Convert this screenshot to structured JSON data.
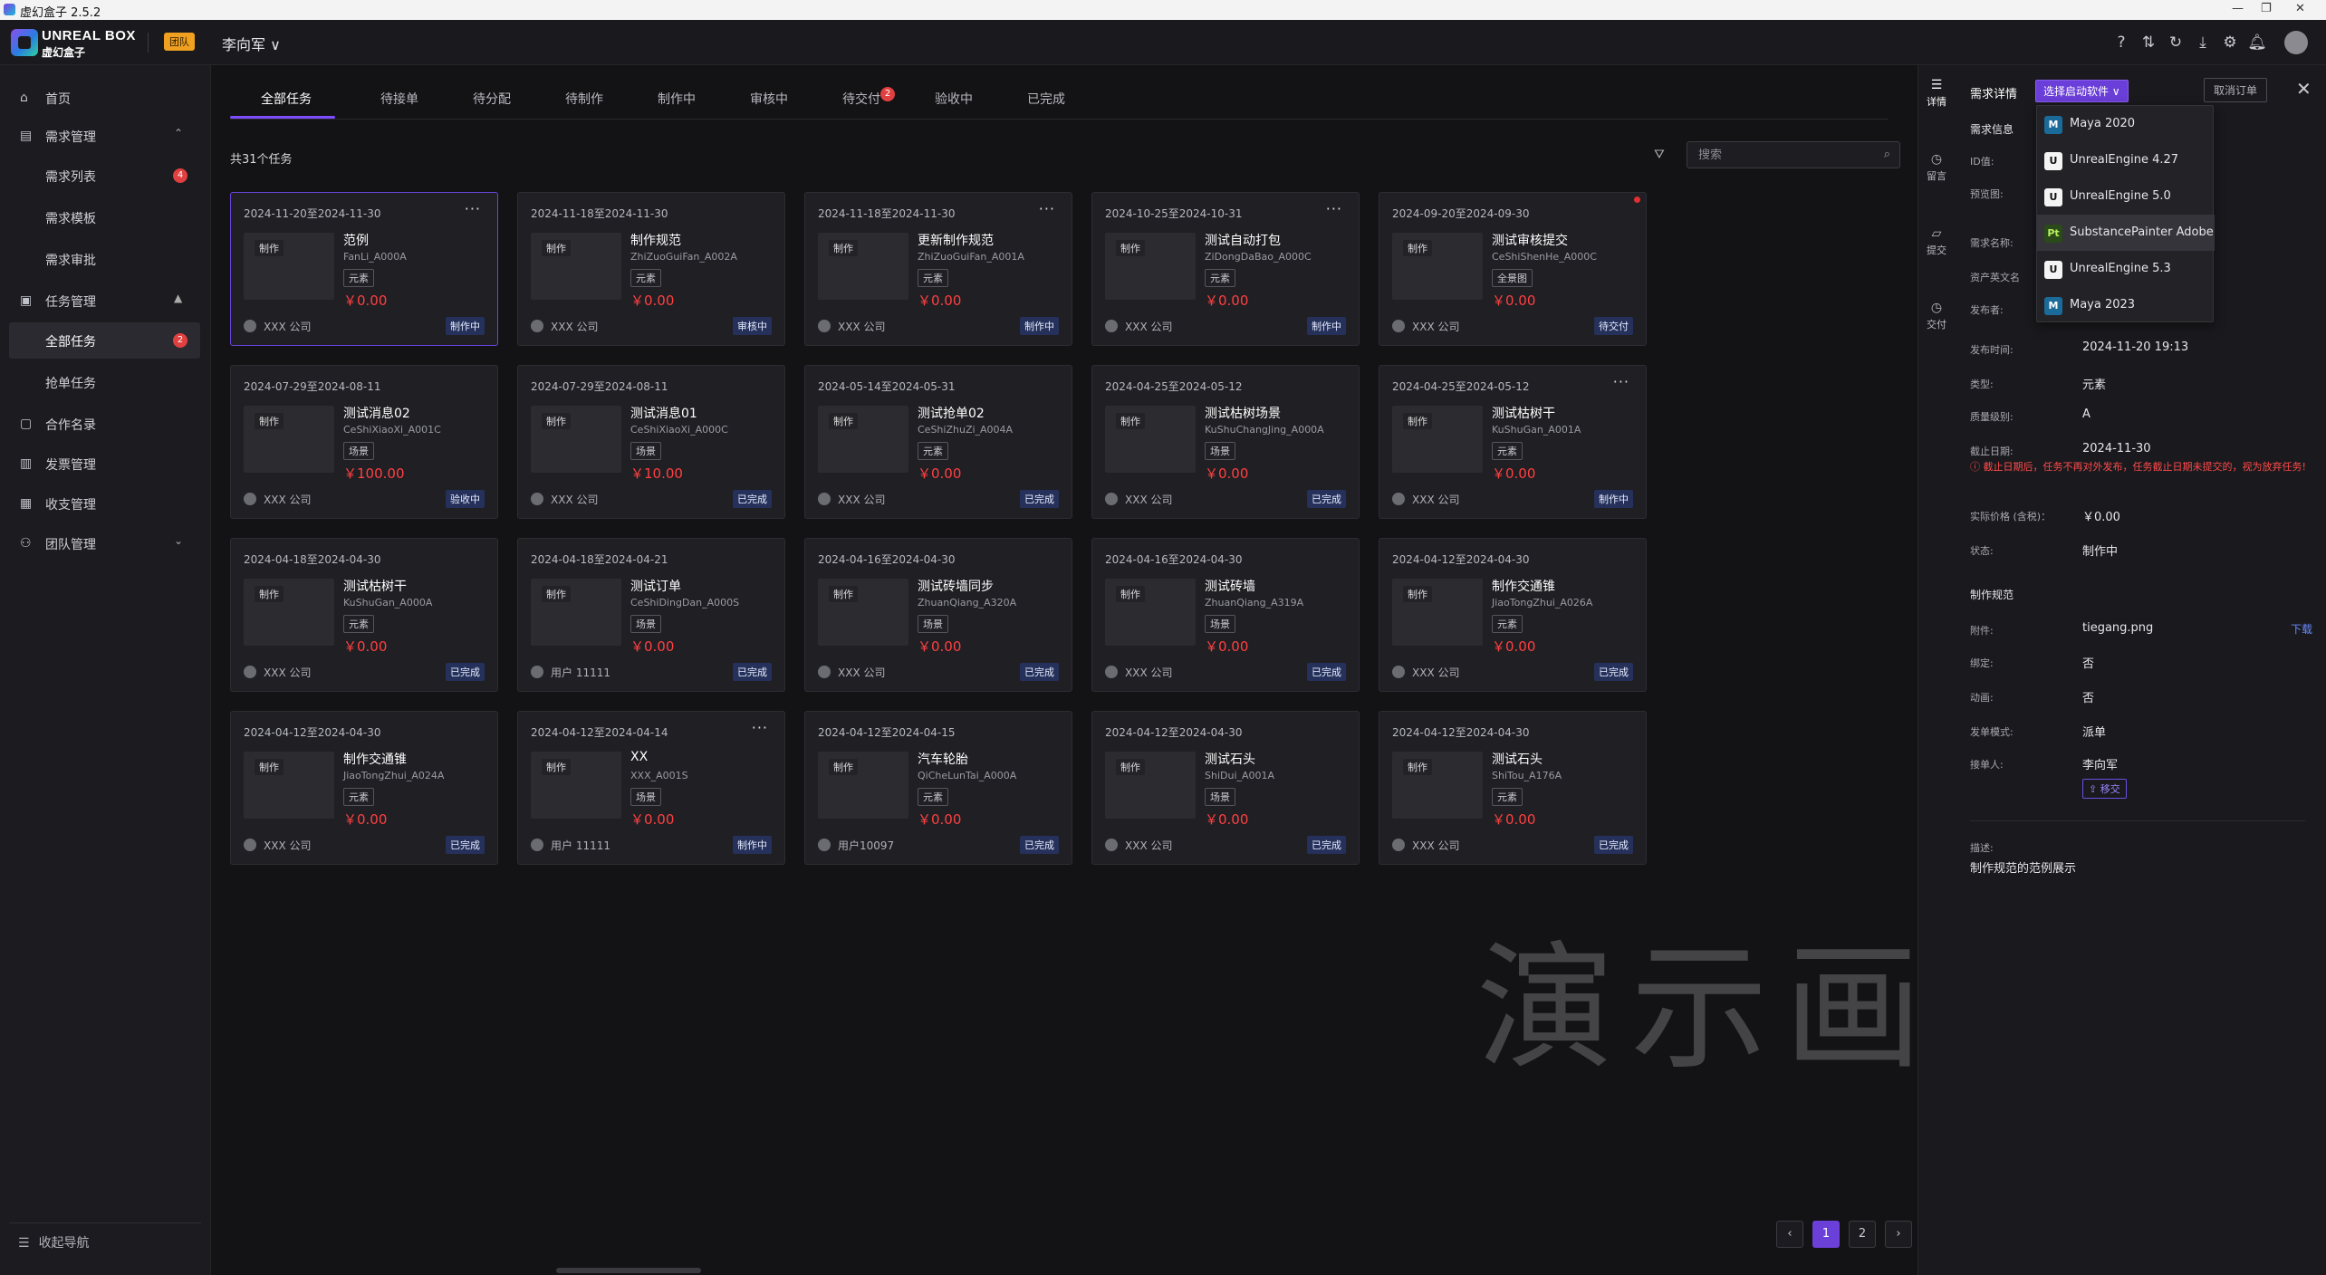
{
  "window": {
    "title": "虚幻盒子 2.5.2"
  },
  "header": {
    "logo_en": "UNREAL BOX",
    "logo_zh": "虚幻盒子",
    "team_badge": "团队",
    "user": "李向军",
    "icons": [
      "help-icon",
      "sort-icon",
      "refresh-icon",
      "download-icon",
      "settings-icon",
      "bell-icon"
    ]
  },
  "sidebar": {
    "items": [
      {
        "label": "首页",
        "icon": "home-icon"
      },
      {
        "label": "需求管理",
        "icon": "document-icon"
      },
      {
        "label": "需求列表",
        "badge": "4"
      },
      {
        "label": "需求模板"
      },
      {
        "label": "需求审批"
      },
      {
        "label": "任务管理",
        "icon": "task-icon"
      },
      {
        "label": "全部任务",
        "badge": "2"
      },
      {
        "label": "抢单任务"
      },
      {
        "label": "合作名录",
        "icon": "book-icon"
      },
      {
        "label": "发票管理",
        "icon": "invoice-icon"
      },
      {
        "label": "收支管理",
        "icon": "wallet-icon"
      },
      {
        "label": "团队管理",
        "icon": "team-icon"
      }
    ],
    "collapse": "收起导航"
  },
  "tabs": [
    {
      "label": "全部任务"
    },
    {
      "label": "待接单"
    },
    {
      "label": "待分配"
    },
    {
      "label": "待制作"
    },
    {
      "label": "制作中"
    },
    {
      "label": "审核中"
    },
    {
      "label": "待交付",
      "badge": "2"
    },
    {
      "label": "验收中"
    },
    {
      "label": "已完成"
    }
  ],
  "list": {
    "total": "共31个任务",
    "search_placeholder": "搜索"
  },
  "cards": [
    {
      "date": "2024-11-20至2024-11-30",
      "tag": "制作",
      "name": "范例",
      "code": "FanLi_A000A",
      "cat": "元素",
      "price": "￥0.00",
      "owner": "XXX 公司",
      "status": "制作中",
      "thumb": "pot",
      "more": true
    },
    {
      "date": "2024-11-18至2024-11-30",
      "tag": "制作",
      "name": "制作规范",
      "code": "ZhiZuoGuiFan_A002A",
      "cat": "元素",
      "price": "￥0.00",
      "owner": "XXX 公司",
      "status": "审核中",
      "thumb": "pot2"
    },
    {
      "date": "2024-11-18至2024-11-30",
      "tag": "制作",
      "name": "更新制作规范",
      "code": "ZhiZuoGuiFan_A001A",
      "cat": "元素",
      "price": "￥0.00",
      "owner": "XXX 公司",
      "status": "制作中",
      "thumb": "color",
      "more": true
    },
    {
      "date": "2024-10-25至2024-10-31",
      "tag": "制作",
      "name": "测试自动打包",
      "code": "ZiDongDaBao_A000C",
      "cat": "元素",
      "price": "￥0.00",
      "owner": "XXX 公司",
      "status": "制作中",
      "thumb": "root",
      "more": true
    },
    {
      "date": "2024-09-20至2024-09-30",
      "tag": "制作",
      "name": "测试审核提交",
      "code": "CeShiShenHe_A000C",
      "cat": "全景图",
      "price": "￥0.00",
      "owner": "XXX 公司",
      "status": "待交付",
      "thumb": "ui",
      "dot": true
    },
    {
      "date": "2024-07-29至2024-08-11",
      "tag": "制作",
      "name": "测试消息02",
      "code": "CeShiXiaoXi_A001C",
      "cat": "场景",
      "price": "￥100.00",
      "owner": "XXX 公司",
      "status": "验收中",
      "thumb": "house"
    },
    {
      "date": "2024-07-29至2024-08-11",
      "tag": "制作",
      "name": "测试消息01",
      "code": "CeShiXiaoXi_A000C",
      "cat": "场景",
      "price": "￥10.00",
      "owner": "XXX 公司",
      "status": "已完成",
      "thumb": "logo"
    },
    {
      "date": "2024-05-14至2024-05-31",
      "tag": "制作",
      "name": "测试抢单02",
      "code": "CeShiZhuZi_A004A",
      "cat": "元素",
      "price": "￥0.00",
      "owner": "XXX 公司",
      "status": "已完成",
      "thumb": "root"
    },
    {
      "date": "2024-04-25至2024-05-12",
      "tag": "制作",
      "name": "测试枯树场景",
      "code": "KuShuChangJing_A000A",
      "cat": "场景",
      "price": "￥0.00",
      "owner": "XXX 公司",
      "status": "已完成",
      "thumb": "root"
    },
    {
      "date": "2024-04-25至2024-05-12",
      "tag": "制作",
      "name": "测试枯树干",
      "code": "KuShuGan_A001A",
      "cat": "元素",
      "price": "￥0.00",
      "owner": "XXX 公司",
      "status": "制作中",
      "thumb": "root",
      "more": true
    },
    {
      "date": "2024-04-18至2024-04-30",
      "tag": "制作",
      "name": "测试枯树干",
      "code": "KuShuGan_A000A",
      "cat": "元素",
      "price": "￥0.00",
      "owner": "XXX 公司",
      "status": "已完成",
      "thumb": "logo"
    },
    {
      "date": "2024-04-18至2024-04-21",
      "tag": "制作",
      "name": "测试订单",
      "code": "CeShiDingDan_A000S",
      "cat": "场景",
      "price": "￥0.00",
      "owner": "用户 11111",
      "status": "已完成",
      "thumb": "food"
    },
    {
      "date": "2024-04-16至2024-04-30",
      "tag": "制作",
      "name": "测试砖墙同步",
      "code": "ZhuanQiang_A320A",
      "cat": "场景",
      "price": "￥0.00",
      "owner": "XXX 公司",
      "status": "已完成",
      "thumb": "wall"
    },
    {
      "date": "2024-04-16至2024-04-30",
      "tag": "制作",
      "name": "测试砖墙",
      "code": "ZhuanQiang_A319A",
      "cat": "场景",
      "price": "￥0.00",
      "owner": "XXX 公司",
      "status": "已完成",
      "thumb": "logo"
    },
    {
      "date": "2024-04-12至2024-04-30",
      "tag": "制作",
      "name": "制作交通锥",
      "code": "JiaoTongZhui_A026A",
      "cat": "元素",
      "price": "￥0.00",
      "owner": "XXX 公司",
      "status": "已完成",
      "thumb": "cone"
    },
    {
      "date": "2024-04-12至2024-04-30",
      "tag": "制作",
      "name": "制作交通锥",
      "code": "JiaoTongZhui_A024A",
      "cat": "元素",
      "price": "￥0.00",
      "owner": "XXX 公司",
      "status": "已完成",
      "thumb": "cone"
    },
    {
      "date": "2024-04-12至2024-04-14",
      "tag": "制作",
      "name": "XX",
      "code": "XXX_A001S",
      "cat": "场景",
      "price": "￥0.00",
      "owner": "用户 11111",
      "status": "制作中",
      "thumb": "party",
      "more": true
    },
    {
      "date": "2024-04-12至2024-04-15",
      "tag": "制作",
      "name": "汽车轮胎",
      "code": "QiCheLunTai_A000A",
      "cat": "元素",
      "price": "￥0.00",
      "owner": "用户10097",
      "status": "已完成",
      "thumb": "tire"
    },
    {
      "date": "2024-04-12至2024-04-30",
      "tag": "制作",
      "name": "测试石头",
      "code": "ShiDui_A001A",
      "cat": "场景",
      "price": "￥0.00",
      "owner": "XXX 公司",
      "status": "已完成",
      "thumb": "stone"
    },
    {
      "date": "2024-04-12至2024-04-30",
      "tag": "制作",
      "name": "测试石头",
      "code": "ShiTou_A176A",
      "cat": "元素",
      "price": "￥0.00",
      "owner": "XXX 公司",
      "status": "已完成",
      "thumb": "rock"
    }
  ],
  "pagination": {
    "prev": "‹",
    "pages": [
      "1",
      "2"
    ],
    "next": "›"
  },
  "watermark": "演示画面",
  "right_strip": [
    {
      "label": "详情",
      "icon": "list-icon"
    },
    {
      "label": "留言",
      "icon": "clock-icon"
    },
    {
      "label": "提交",
      "icon": "folder-icon"
    },
    {
      "label": "交付",
      "icon": "clock-icon"
    }
  ],
  "detail": {
    "title": "需求详情",
    "launch_button": "选择启动软件",
    "cancel_button": "取消订单",
    "info_section": "需求信息",
    "fields": [
      {
        "label": "ID值:",
        "value": ""
      },
      {
        "label": "预览图:",
        "value": ""
      },
      {
        "label": "需求名称:",
        "value": ""
      },
      {
        "label": "资产英文名",
        "value": ""
      },
      {
        "label": "发布者:",
        "value": ""
      },
      {
        "label": "发布时间:",
        "value": "2024-11-20 19:13"
      },
      {
        "label": "类型:",
        "value": "元素"
      },
      {
        "label": "质量级别:",
        "value": "A"
      },
      {
        "label": "截止日期:",
        "value": "2024-11-30"
      }
    ],
    "warning": "ⓘ 截止日期后，任务不再对外发布，任务截止日期未提交的，视为放弃任务!",
    "fields2": [
      {
        "label": "实际价格 (含税)：",
        "value": "￥0.00"
      },
      {
        "label": "状态:",
        "value": "制作中"
      }
    ],
    "spec_section": "制作规范",
    "fields3": [
      {
        "label": "附件:",
        "value": "tiegang.png"
      },
      {
        "label": "绑定:",
        "value": "否"
      },
      {
        "label": "动画:",
        "value": "否"
      },
      {
        "label": "发单模式:",
        "value": "派单"
      },
      {
        "label": "接单人:",
        "value": "李向军"
      }
    ],
    "download": "下载",
    "transfer": "移交",
    "desc_label": "描述:",
    "desc": "制作规范的范例展示"
  },
  "software_dropdown": [
    {
      "label": "Maya 2020",
      "icon": "maya-icon"
    },
    {
      "label": "UnrealEngine 4.27",
      "icon": "unreal-icon"
    },
    {
      "label": "UnrealEngine 5.0",
      "icon": "unreal-icon"
    },
    {
      "label": "SubstancePainter Adobe",
      "icon": "substance-painter-icon"
    },
    {
      "label": "UnrealEngine 5.3",
      "icon": "unreal-icon"
    },
    {
      "label": "Maya 2023",
      "icon": "maya-icon"
    }
  ]
}
